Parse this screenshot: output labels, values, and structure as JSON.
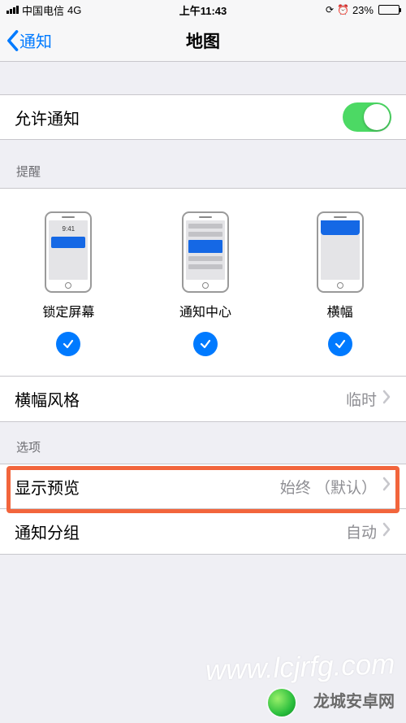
{
  "status": {
    "carrier": "中国电信",
    "network": "4G",
    "time": "上午11:43",
    "battery_pct": "23%"
  },
  "nav": {
    "back_label": "通知",
    "title": "地图"
  },
  "allow": {
    "label": "允许通知",
    "on": true
  },
  "sections": {
    "alerts_header": "提醒",
    "options_header": "选项"
  },
  "alert_styles": {
    "lock": {
      "label": "锁定屏幕",
      "preview_time": "9:41",
      "checked": true
    },
    "center": {
      "label": "通知中心",
      "checked": true
    },
    "banner": {
      "label": "横幅",
      "checked": true
    }
  },
  "banner_style": {
    "label": "横幅风格",
    "value": "临时"
  },
  "preview": {
    "label": "显示预览",
    "value": "始终 （默认）"
  },
  "grouping": {
    "label": "通知分组",
    "value": "自动"
  },
  "watermark": {
    "site": "龙城安卓网",
    "url": "www.lcjrfg.com"
  }
}
